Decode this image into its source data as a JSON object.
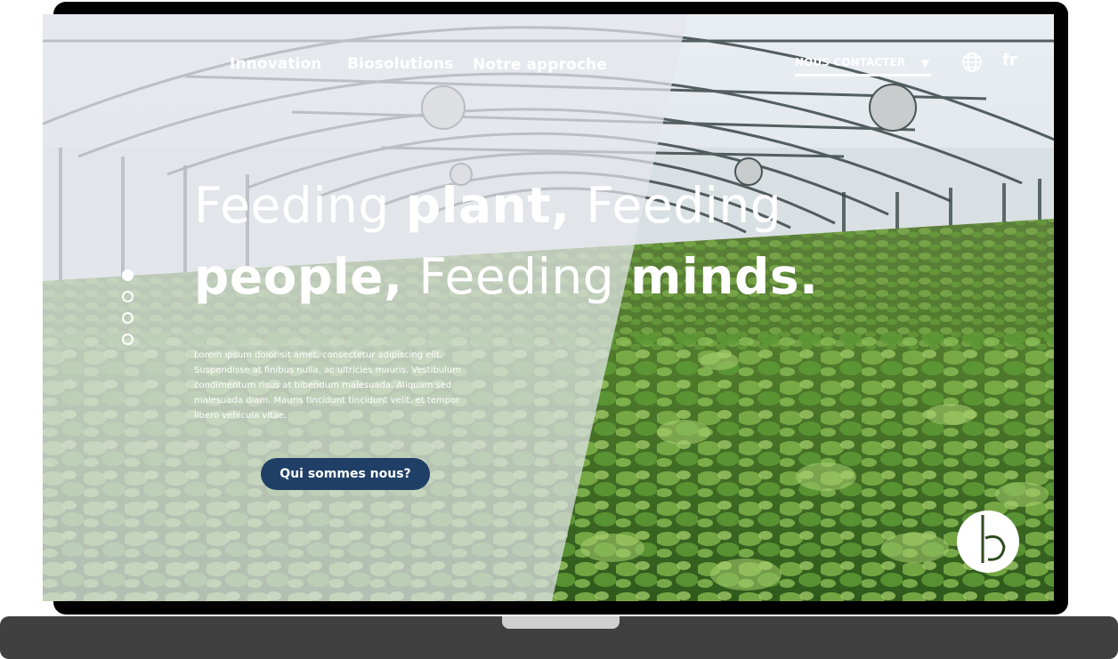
{
  "nav": {
    "items": [
      {
        "label": "Innovation"
      },
      {
        "label": "Biosolutions"
      },
      {
        "label": "Notre approche"
      }
    ],
    "contact_label": "NOUS CONTACTER",
    "language": "fr"
  },
  "hero": {
    "line1": {
      "a": "Feeding ",
      "b": "plant,",
      "c": " Feeding"
    },
    "line2": {
      "a": "people,",
      "b": " Feeding ",
      "c": "minds."
    },
    "body": "Lorem ipsum dolor sit amet, consectetur adipiscing elit. Suspendisse at finibus nulla, ac ultricies mauris. Vestibulum condimentum risus at bibendum malesuada. Aliquam sed malesuada diam. Mauris tincidunt tincidunt velit, et tempor libero vehicula vitae.",
    "cta_label": "Qui sommes nous?"
  },
  "slider": {
    "count": 4,
    "active_index": 0
  },
  "colors": {
    "cta_bg": "#1f3f66",
    "overlay": "#e4e6eb",
    "text": "#ffffff"
  },
  "icons": {
    "globe": "globe-icon",
    "caret": "caret-down-icon",
    "logo": "brand-logo"
  }
}
